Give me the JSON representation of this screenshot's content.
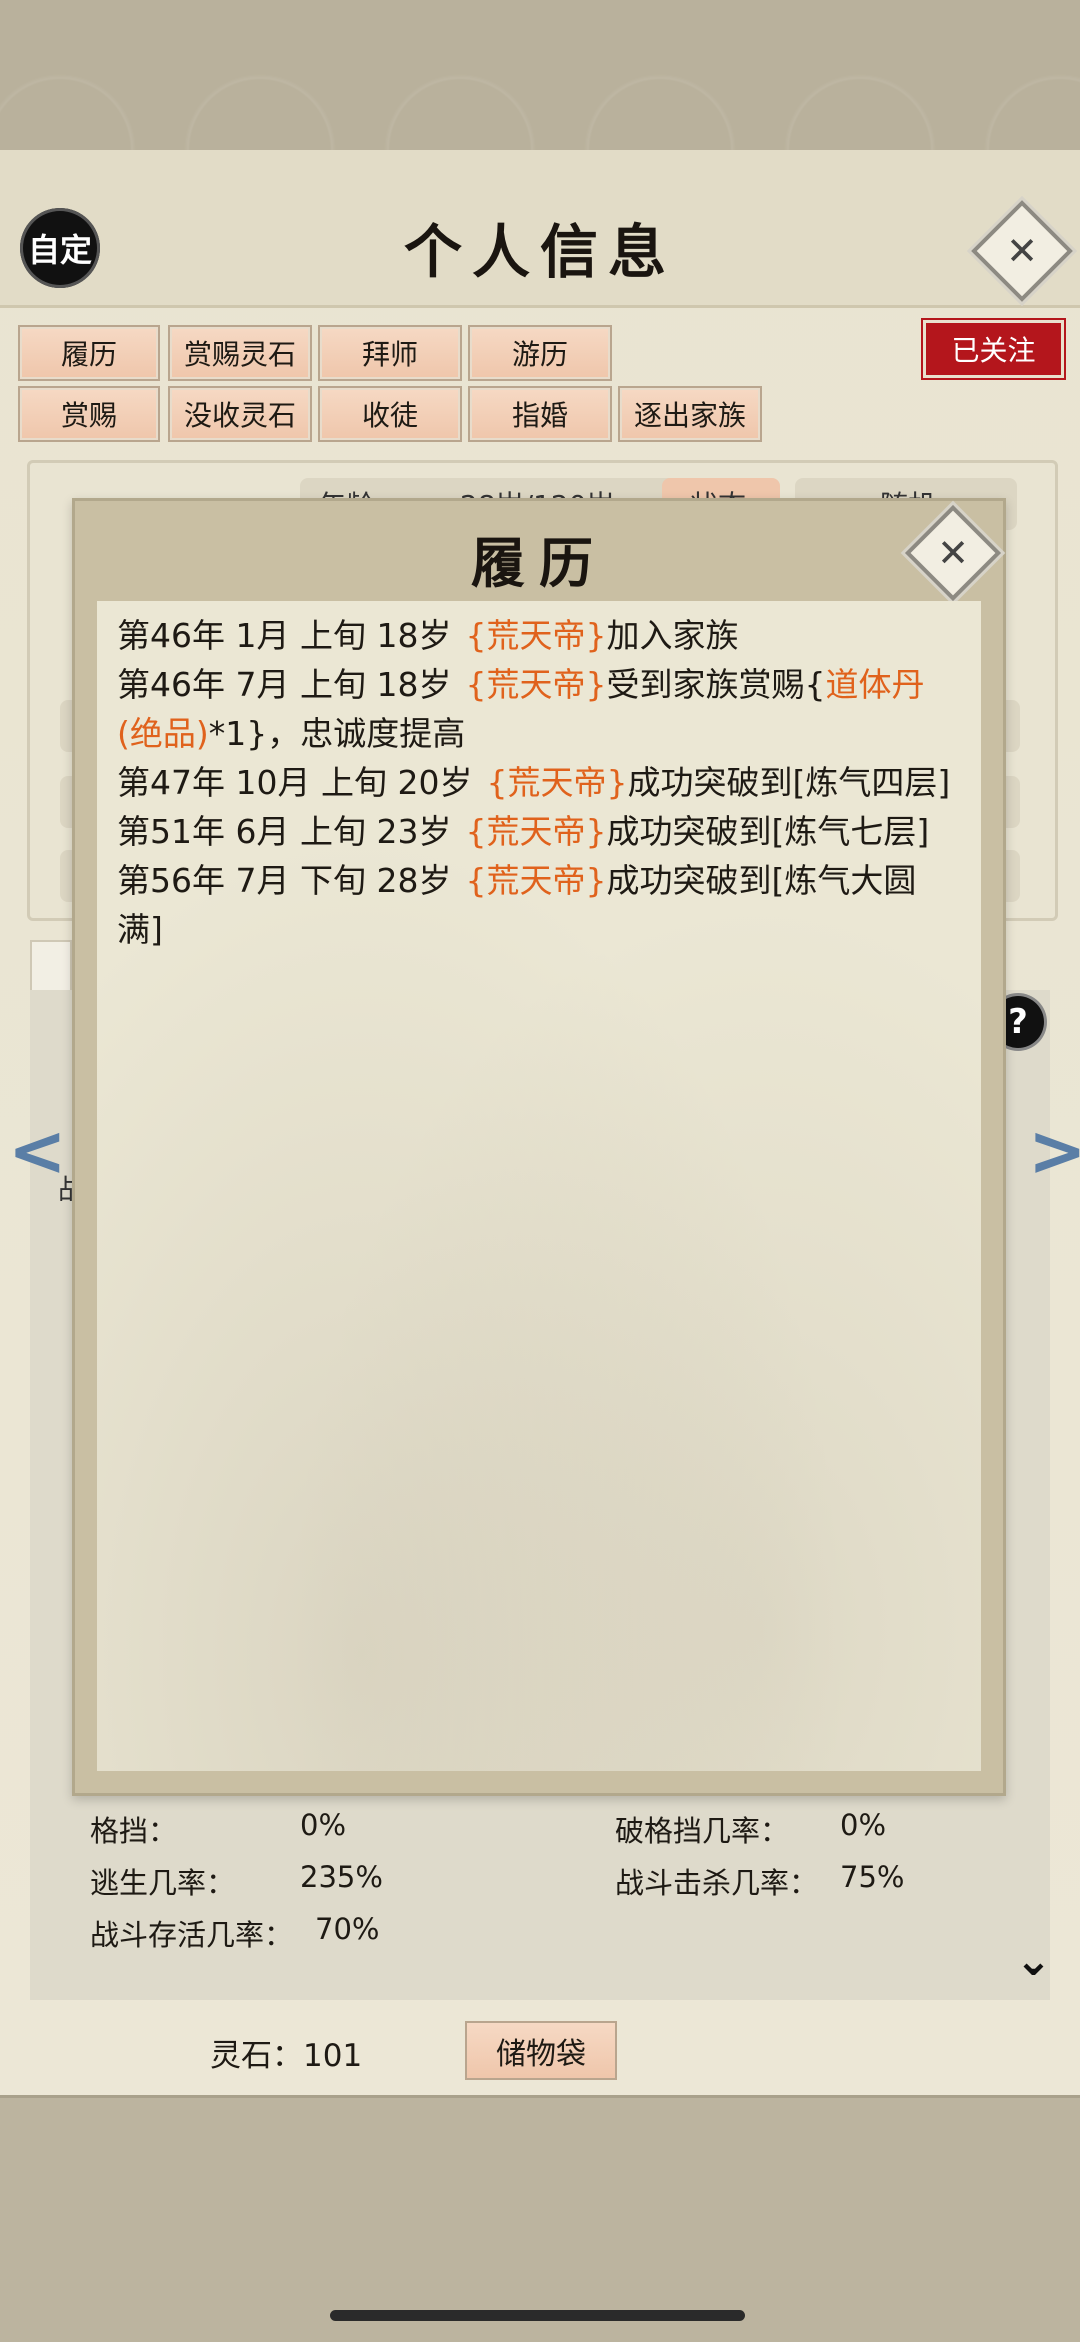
{
  "header": {
    "auto_label": "自定",
    "title": "个人信息",
    "close_icon": "close-icon"
  },
  "tabs_row1": [
    "履历",
    "赏赐灵石",
    "拜师",
    "游历"
  ],
  "tabs_row2": [
    "赏赐",
    "没收灵石",
    "收徒",
    "指婚",
    "逐出家族"
  ],
  "followed_label": "已关注",
  "behind_modal": {
    "age_partial": "年龄",
    "age_value_partial": "28岁/120岁",
    "status_partial": "状态",
    "random_partial": "随机",
    "lower_label_partial": "战"
  },
  "modal": {
    "title": "履历",
    "records": [
      {
        "time": "第46年 1月 上旬  18岁",
        "name": "{荒天帝}",
        "text": "加入家族",
        "item": "",
        "tail": ""
      },
      {
        "time": "第46年 7月 上旬  18岁",
        "name": "{荒天帝}",
        "text": "受到家族赏赐{",
        "item": "道体丹(绝品)",
        "tail": "*1}，忠诚度提高"
      },
      {
        "time": "第47年 10月 上旬 20岁",
        "name": "{荒天帝}",
        "text": "成功突破到[炼气四层]",
        "item": "",
        "tail": ""
      },
      {
        "time": "第51年 6月 上旬  23岁",
        "name": "{荒天帝}",
        "text": "成功突破到[炼气七层]",
        "item": "",
        "tail": ""
      },
      {
        "time": "第56年 7月 下旬  28岁",
        "name": "{荒天帝}",
        "text": "成功突破到[炼气大圆满]",
        "item": "",
        "tail": ""
      }
    ]
  },
  "stats": {
    "block_label": "格挡：",
    "block_value": "0%",
    "break_block_label": "破格挡几率：",
    "break_block_value": "0%",
    "escape_label": "逃生几率：",
    "escape_value": "235%",
    "kill_label": "战斗击杀几率：",
    "kill_value": "75%",
    "survive_label": "战斗存活几率：",
    "survive_value": "70%"
  },
  "footer": {
    "spirit_stone": "灵石：101",
    "bag_label": "储物袋"
  },
  "colors": {
    "highlight": "#e0621c",
    "followed_bg": "#b4161c",
    "tab_bg": "#efc6ab"
  }
}
